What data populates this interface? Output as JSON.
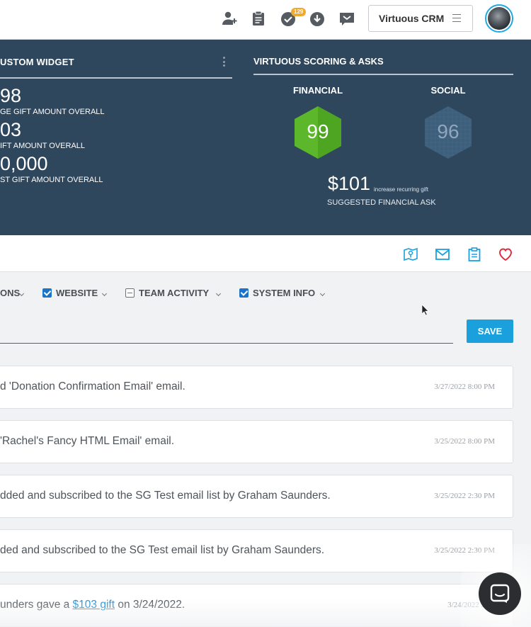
{
  "topbar": {
    "icons": [
      "add-user-icon",
      "clipboard-icon",
      "tasks-check-icon",
      "download-icon",
      "inbox-icon"
    ],
    "tasks_badge": "129",
    "crm_button_label": "Virtuous CRM"
  },
  "custom_widget": {
    "title": "USTOM WIDGET",
    "stats": [
      {
        "value": "98",
        "label": "GE GIFT AMOUNT OVERALL"
      },
      {
        "value": "03",
        "label": "IFT AMOUNT OVERALL"
      },
      {
        "value": "0,000",
        "label": "ST GIFT AMOUNT OVERALL"
      }
    ]
  },
  "scoring": {
    "title": "VIRTUOUS SCORING & ASKS",
    "financial": {
      "label": "FINANCIAL",
      "score": "99",
      "color": "#5cb82a"
    },
    "social": {
      "label": "SOCIAL",
      "score": "96",
      "color": "#3e5f7c"
    },
    "ask_amount": "$101",
    "ask_note": "increase recurring gift",
    "ask_label": "SUGGESTED FINANCIAL ASK"
  },
  "actions": {
    "icons": [
      "map-icon",
      "email-icon",
      "clipboard-icon",
      "heart-icon"
    ],
    "accent": "#1aa0dc",
    "heart_color": "#e0283c"
  },
  "filters": {
    "items": [
      {
        "label": "ONS",
        "state": "none"
      },
      {
        "label": "WEBSITE",
        "state": "checked"
      },
      {
        "label": "TEAM ACTIVITY",
        "state": "partial"
      },
      {
        "label": "SYSTEM INFO",
        "state": "checked"
      }
    ]
  },
  "note_input": {
    "value": ""
  },
  "save_label": "SAVE",
  "timeline": [
    {
      "text": "d 'Donation Confirmation Email' email.",
      "date": "3/27/2022 8:00 PM"
    },
    {
      "text": "'Rachel's Fancy HTML Email' email.",
      "date": "3/25/2022 8:00 PM"
    },
    {
      "text": "dded and subscribed to the SG Test email list by Graham Saunders.",
      "date": "3/25/2022 2:30 PM"
    },
    {
      "text": "ded and subscribed to the SG Test email list by Graham Saunders.",
      "date": "3/25/2022 2:30 PM"
    },
    {
      "text_before": "unders gave a ",
      "link": "$103 gift",
      "text_after": " on 3/24/2022.",
      "date": "3/24/2022 2:09"
    }
  ]
}
